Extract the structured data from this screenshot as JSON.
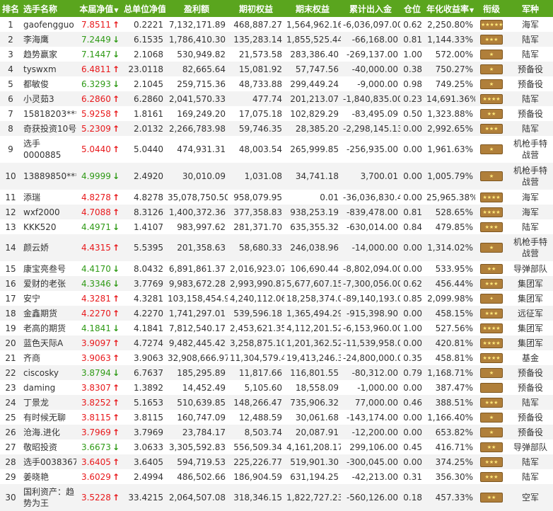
{
  "headers": {
    "rank": "排名",
    "name": "选手名称",
    "nav": "本届净值",
    "unit_nav": "总单位净值",
    "profit": "盈利额",
    "start_equity": "期初权益",
    "end_equity": "期末权益",
    "net_flow": "累计出入金",
    "position": "仓位",
    "annual": "年化收益率",
    "grade": "衔级",
    "army": "军种"
  },
  "colors": {
    "header_bg": "#5aa51e",
    "up": "#e8191c",
    "down": "#2f9a16",
    "badge": "#b07f3a"
  },
  "rows": [
    {
      "rank": "1",
      "name": "gaofengguo",
      "nav": "7.8511",
      "dir": "up",
      "unit_nav": "0.2221",
      "profit": "7,132,171.89",
      "start": "468,887.27",
      "end": "1,564,962.16",
      "flow": "-6,036,097.00",
      "pos": "0.62",
      "annual": "2,250.80%",
      "stars": "★★★★★",
      "army": "海军"
    },
    {
      "rank": "2",
      "name": "李海鹰",
      "nav": "7.2449",
      "dir": "down",
      "unit_nav": "6.1535",
      "profit": "1,786,410.30",
      "start": "135,283.14",
      "end": "1,855,525.44",
      "flow": "-66,168.00",
      "pos": "0.81",
      "annual": "1,144.33%",
      "stars": "★★★",
      "army": "陆军"
    },
    {
      "rank": "3",
      "name": "趋势赢家",
      "nav": "7.1447",
      "dir": "down",
      "unit_nav": "2.1068",
      "profit": "530,949.82",
      "start": "21,573.58",
      "end": "283,386.40",
      "flow": "-269,137.00",
      "pos": "1.00",
      "annual": "572.00%",
      "stars": "★",
      "army": "陆军"
    },
    {
      "rank": "4",
      "name": "tyswxm",
      "nav": "6.4811",
      "dir": "up",
      "unit_nav": "23.0118",
      "profit": "82,665.64",
      "start": "15,081.92",
      "end": "57,747.56",
      "flow": "-40,000.00",
      "pos": "0.38",
      "annual": "750.27%",
      "stars": "★",
      "army": "预备役"
    },
    {
      "rank": "5",
      "name": "都敏俊",
      "nav": "6.3293",
      "dir": "down",
      "unit_nav": "2.1045",
      "profit": "259,715.36",
      "start": "48,733.88",
      "end": "299,449.24",
      "flow": "-9,000.00",
      "pos": "0.98",
      "annual": "749.25%",
      "stars": "★",
      "army": "预备役"
    },
    {
      "rank": "6",
      "name": "小灵茹3",
      "nav": "6.2860",
      "dir": "up",
      "unit_nav": "6.2860",
      "profit": "2,041,570.33",
      "start": "477.74",
      "end": "201,213.07",
      "flow": "-1,840,835.00",
      "pos": "0.23",
      "annual": "14,691.36%",
      "stars": "★★★★",
      "army": "陆军"
    },
    {
      "rank": "7",
      "name": "15818203***",
      "nav": "5.9258",
      "dir": "up",
      "unit_nav": "1.8161",
      "profit": "169,249.20",
      "start": "17,075.18",
      "end": "102,829.29",
      "flow": "-83,495.09",
      "pos": "0.50",
      "annual": "1,323.88%",
      "stars": "★★",
      "army": "预备役"
    },
    {
      "rank": "8",
      "name": "奇获投资10号",
      "nav": "5.2309",
      "dir": "up",
      "unit_nav": "2.0132",
      "profit": "2,266,783.98",
      "start": "59,746.35",
      "end": "28,385.20",
      "flow": "-2,298,145.13",
      "pos": "0.00",
      "annual": "2,992.65%",
      "stars": "★★★",
      "army": "陆军"
    },
    {
      "rank": "9",
      "name": "选手0000885",
      "nav": "5.0440",
      "dir": "up",
      "unit_nav": "5.0440",
      "profit": "474,931.31",
      "start": "48,003.54",
      "end": "265,999.85",
      "flow": "-256,935.00",
      "pos": "0.00",
      "annual": "1,961.63%",
      "stars": "★",
      "army": "机枪手特战营"
    },
    {
      "rank": "10",
      "name": "13889850***",
      "nav": "4.9999",
      "dir": "down",
      "unit_nav": "2.4920",
      "profit": "30,010.09",
      "start": "1,031.08",
      "end": "34,741.18",
      "flow": "3,700.01",
      "pos": "0.00",
      "annual": "1,005.79%",
      "stars": "★",
      "army": "机枪手特战营"
    },
    {
      "rank": "11",
      "name": "添瑞",
      "nav": "4.8278",
      "dir": "up",
      "unit_nav": "4.8278",
      "profit": "35,078,750.50",
      "start": "958,079.95",
      "end": "0.01",
      "flow": "-36,036,830.44",
      "pos": "0.00",
      "annual": "25,965.38%",
      "stars": "★★★★",
      "army": "海军"
    },
    {
      "rank": "12",
      "name": "wxf2000",
      "nav": "4.7088",
      "dir": "up",
      "unit_nav": "8.3126",
      "profit": "1,400,372.36",
      "start": "377,358.83",
      "end": "938,253.19",
      "flow": "-839,478.00",
      "pos": "0.81",
      "annual": "528.65%",
      "stars": "★★★★",
      "army": "海军"
    },
    {
      "rank": "13",
      "name": "KKK520",
      "nav": "4.4971",
      "dir": "down",
      "unit_nav": "1.4107",
      "profit": "983,997.62",
      "start": "281,371.70",
      "end": "635,355.32",
      "flow": "-630,014.00",
      "pos": "0.84",
      "annual": "479.85%",
      "stars": "★★★",
      "army": "陆军"
    },
    {
      "rank": "14",
      "name": "颜云娇",
      "nav": "4.4315",
      "dir": "up",
      "unit_nav": "5.5395",
      "profit": "201,358.63",
      "start": "58,680.33",
      "end": "246,038.96",
      "flow": "-14,000.00",
      "pos": "0.00",
      "annual": "1,314.02%",
      "stars": "★",
      "army": "机枪手特战营"
    },
    {
      "rank": "15",
      "name": "康宝亮叁号",
      "nav": "4.4170",
      "dir": "down",
      "unit_nav": "8.0432",
      "profit": "6,891,861.37",
      "start": "2,016,923.07",
      "end": "106,690.44",
      "flow": "-8,802,094.00",
      "pos": "0.00",
      "annual": "533.95%",
      "stars": "★★",
      "army": "导弹部队"
    },
    {
      "rank": "16",
      "name": "爱财的老张",
      "nav": "4.3346",
      "dir": "down",
      "unit_nav": "3.7769",
      "profit": "9,983,672.28",
      "start": "2,993,990.87",
      "end": "5,677,607.15",
      "flow": "-7,300,056.00",
      "pos": "0.62",
      "annual": "456.44%",
      "stars": "★★★",
      "army": "集团军"
    },
    {
      "rank": "17",
      "name": "安宁",
      "nav": "4.3281",
      "dir": "up",
      "unit_nav": "4.3281",
      "profit": "103,158,454.99",
      "start": "4,240,112.06",
      "end": "18,258,374.05",
      "flow": "-89,140,193.00",
      "pos": "0.85",
      "annual": "2,099.98%",
      "stars": "✦",
      "army": "集团军"
    },
    {
      "rank": "18",
      "name": "金鑫期货",
      "nav": "4.2270",
      "dir": "up",
      "unit_nav": "4.2270",
      "profit": "1,741,297.01",
      "start": "539,596.18",
      "end": "1,365,494.29",
      "flow": "-915,398.90",
      "pos": "0.00",
      "annual": "458.15%",
      "stars": "★★★",
      "army": "远征军"
    },
    {
      "rank": "19",
      "name": "老高的期货",
      "nav": "4.1841",
      "dir": "down",
      "unit_nav": "4.1841",
      "profit": "7,812,540.17",
      "start": "2,453,621.35",
      "end": "4,112,201.52",
      "flow": "-6,153,960.00",
      "pos": "1.00",
      "annual": "527.56%",
      "stars": "★★★★",
      "army": "集团军"
    },
    {
      "rank": "20",
      "name": "蓝色天际A",
      "nav": "3.9097",
      "dir": "up",
      "unit_nav": "4.7274",
      "profit": "9,482,445.42",
      "start": "3,258,875.10",
      "end": "1,201,362.52",
      "flow": "-11,539,958.00",
      "pos": "0.00",
      "annual": "420.81%",
      "stars": "★★★★",
      "army": "集团军"
    },
    {
      "rank": "21",
      "name": "齐商",
      "nav": "3.9063",
      "dir": "up",
      "unit_nav": "3.9063",
      "profit": "32,908,666.97",
      "start": "11,304,579.40",
      "end": "19,413,246.37",
      "flow": "-24,800,000.00",
      "pos": "0.35",
      "annual": "458.81%",
      "stars": "★★★★",
      "army": "基金"
    },
    {
      "rank": "22",
      "name": "ciscosky",
      "nav": "3.8794",
      "dir": "down",
      "unit_nav": "6.7637",
      "profit": "185,295.89",
      "start": "11,817.66",
      "end": "116,801.55",
      "flow": "-80,312.00",
      "pos": "0.79",
      "annual": "1,168.71%",
      "stars": "★",
      "army": "预备役"
    },
    {
      "rank": "23",
      "name": "daming",
      "nav": "3.8307",
      "dir": "up",
      "unit_nav": "1.3892",
      "profit": "14,452.49",
      "start": "5,105.60",
      "end": "18,558.09",
      "flow": "-1,000.00",
      "pos": "0.00",
      "annual": "387.47%",
      "stars": "",
      "army": "预备役"
    },
    {
      "rank": "24",
      "name": "丁景龙",
      "nav": "3.8252",
      "dir": "up",
      "unit_nav": "5.1653",
      "profit": "510,639.85",
      "start": "148,266.47",
      "end": "735,906.32",
      "flow": "77,000.00",
      "pos": "0.46",
      "annual": "388.51%",
      "stars": "★★★",
      "army": "陆军"
    },
    {
      "rank": "25",
      "name": "有时候无聊",
      "nav": "3.8115",
      "dir": "up",
      "unit_nav": "3.8115",
      "profit": "160,747.09",
      "start": "12,488.59",
      "end": "30,061.68",
      "flow": "-143,174.00",
      "pos": "0.00",
      "annual": "1,166.40%",
      "stars": "★",
      "army": "预备役"
    },
    {
      "rank": "26",
      "name": "沧海.进化",
      "nav": "3.7969",
      "dir": "up",
      "unit_nav": "3.7969",
      "profit": "23,784.17",
      "start": "8,503.74",
      "end": "20,087.91",
      "flow": "-12,200.00",
      "pos": "0.00",
      "annual": "653.82%",
      "stars": "★",
      "army": "预备役"
    },
    {
      "rank": "27",
      "name": "敬昭投资",
      "nav": "3.6673",
      "dir": "down",
      "unit_nav": "3.0633",
      "profit": "3,305,592.83",
      "start": "556,509.34",
      "end": "4,161,208.17",
      "flow": "299,106.00",
      "pos": "0.45",
      "annual": "416.71%",
      "stars": "★★",
      "army": "导弹部队"
    },
    {
      "rank": "28",
      "name": "选手0038367",
      "nav": "3.6405",
      "dir": "up",
      "unit_nav": "3.6405",
      "profit": "594,719.53",
      "start": "225,226.77",
      "end": "519,901.30",
      "flow": "-300,045.00",
      "pos": "0.00",
      "annual": "374.25%",
      "stars": "★★★",
      "army": "陆军"
    },
    {
      "rank": "29",
      "name": "姜晓艳",
      "nav": "3.6029",
      "dir": "up",
      "unit_nav": "2.4994",
      "profit": "486,502.66",
      "start": "186,904.59",
      "end": "631,194.25",
      "flow": "-42,213.00",
      "pos": "0.31",
      "annual": "356.30%",
      "stars": "★★★",
      "army": "陆军"
    },
    {
      "rank": "30",
      "name": "国利资产：趋势为王",
      "nav": "3.5228",
      "dir": "up",
      "unit_nav": "33.4215",
      "profit": "2,064,507.08",
      "start": "318,346.15",
      "end": "1,822,727.23",
      "flow": "-560,126.00",
      "pos": "0.18",
      "annual": "457.33%",
      "stars": "★★",
      "army": "空军"
    }
  ]
}
